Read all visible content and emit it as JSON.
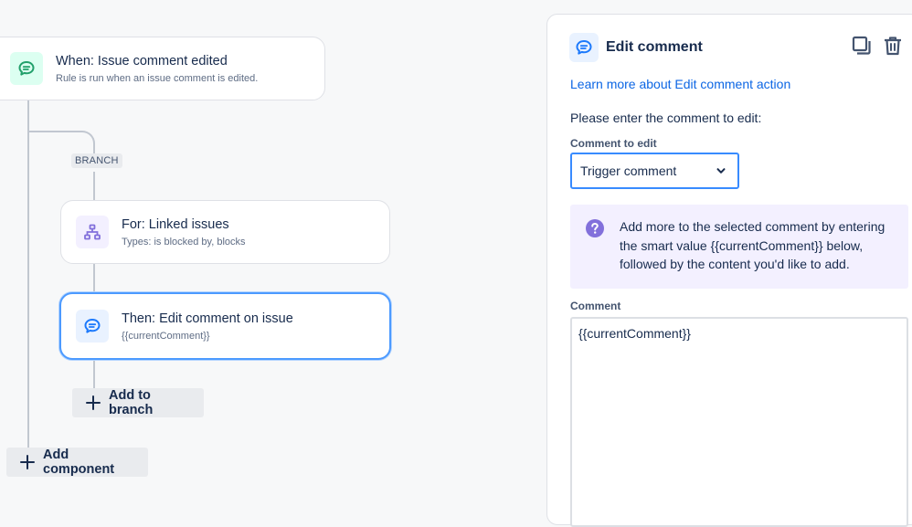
{
  "canvas": {
    "trigger": {
      "title": "When: Issue comment edited",
      "subtitle": "Rule is run when an issue comment is edited."
    },
    "branch_tag": "BRANCH",
    "branch_card": {
      "title": "For: Linked issues",
      "subtitle": "Types: is blocked by, blocks"
    },
    "action_card": {
      "title": "Then: Edit comment on issue",
      "subtitle": "{{currentComment}}"
    },
    "add_to_branch_label": "Add to branch",
    "add_component_label": "Add component"
  },
  "panel": {
    "title": "Edit comment",
    "learn_link": "Learn more about Edit comment action",
    "prompt": "Please enter the comment to edit:",
    "comment_to_edit_label": "Comment to edit",
    "comment_to_edit_value": "Trigger comment",
    "info_text": "Add more to the selected comment by entering the smart value {{currentComment}} below, followed by the content you'd like to add.",
    "comment_label": "Comment",
    "comment_value": "{{currentComment}}"
  },
  "colors": {
    "trigger_icon_bg": "#dcfff1",
    "trigger_icon": "#22a06b",
    "branch_icon_bg": "#f3f0ff",
    "branch_icon": "#8270db",
    "action_icon_bg": "#e9f2ff",
    "action_icon": "#1d7afc",
    "link": "#0c66e4",
    "selected_border": "#4c9aff",
    "info_bg": "#f3f0ff"
  },
  "icons": {
    "trigger": "comment-icon",
    "branch": "hierarchy-icon",
    "action": "comment-icon",
    "duplicate": "duplicate-icon",
    "delete": "trash-icon",
    "info": "question-circle-icon",
    "select": "chevron-down-icon",
    "add": "plus-icon"
  }
}
